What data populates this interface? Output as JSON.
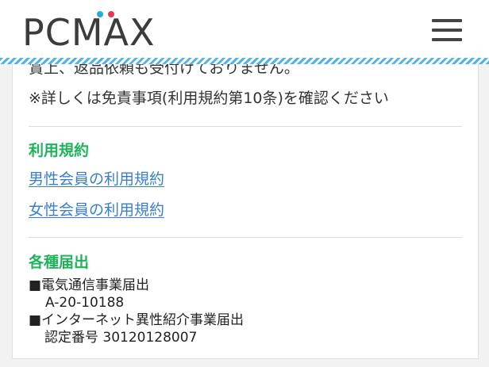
{
  "header": {
    "logo_text": "PCMAX",
    "logo_dot_colors": [
      "#29a8e0",
      "#e53a56"
    ],
    "menu_icon": "hamburger-menu-icon"
  },
  "notice": {
    "line1": "賞上、返品依頼も受付けておりません。",
    "line2": "※詳しくは免責事項(利用規約第10条)を確認ください"
  },
  "terms": {
    "title": "利用規約",
    "male_link": "男性会員の利用規約",
    "female_link": "女性会員の利用規約"
  },
  "filings": {
    "title": "各種届出",
    "telecom_label": "■電気通信事業届出",
    "telecom_number": "A-20-10188",
    "internet_label": "■インターネット異性紹介事業届出",
    "internet_number": "認定番号 30120128007"
  },
  "colors": {
    "accent_green": "#1fb45c",
    "link_blue": "#3a7fcf",
    "stripe_blue": "#4fb5e6"
  }
}
